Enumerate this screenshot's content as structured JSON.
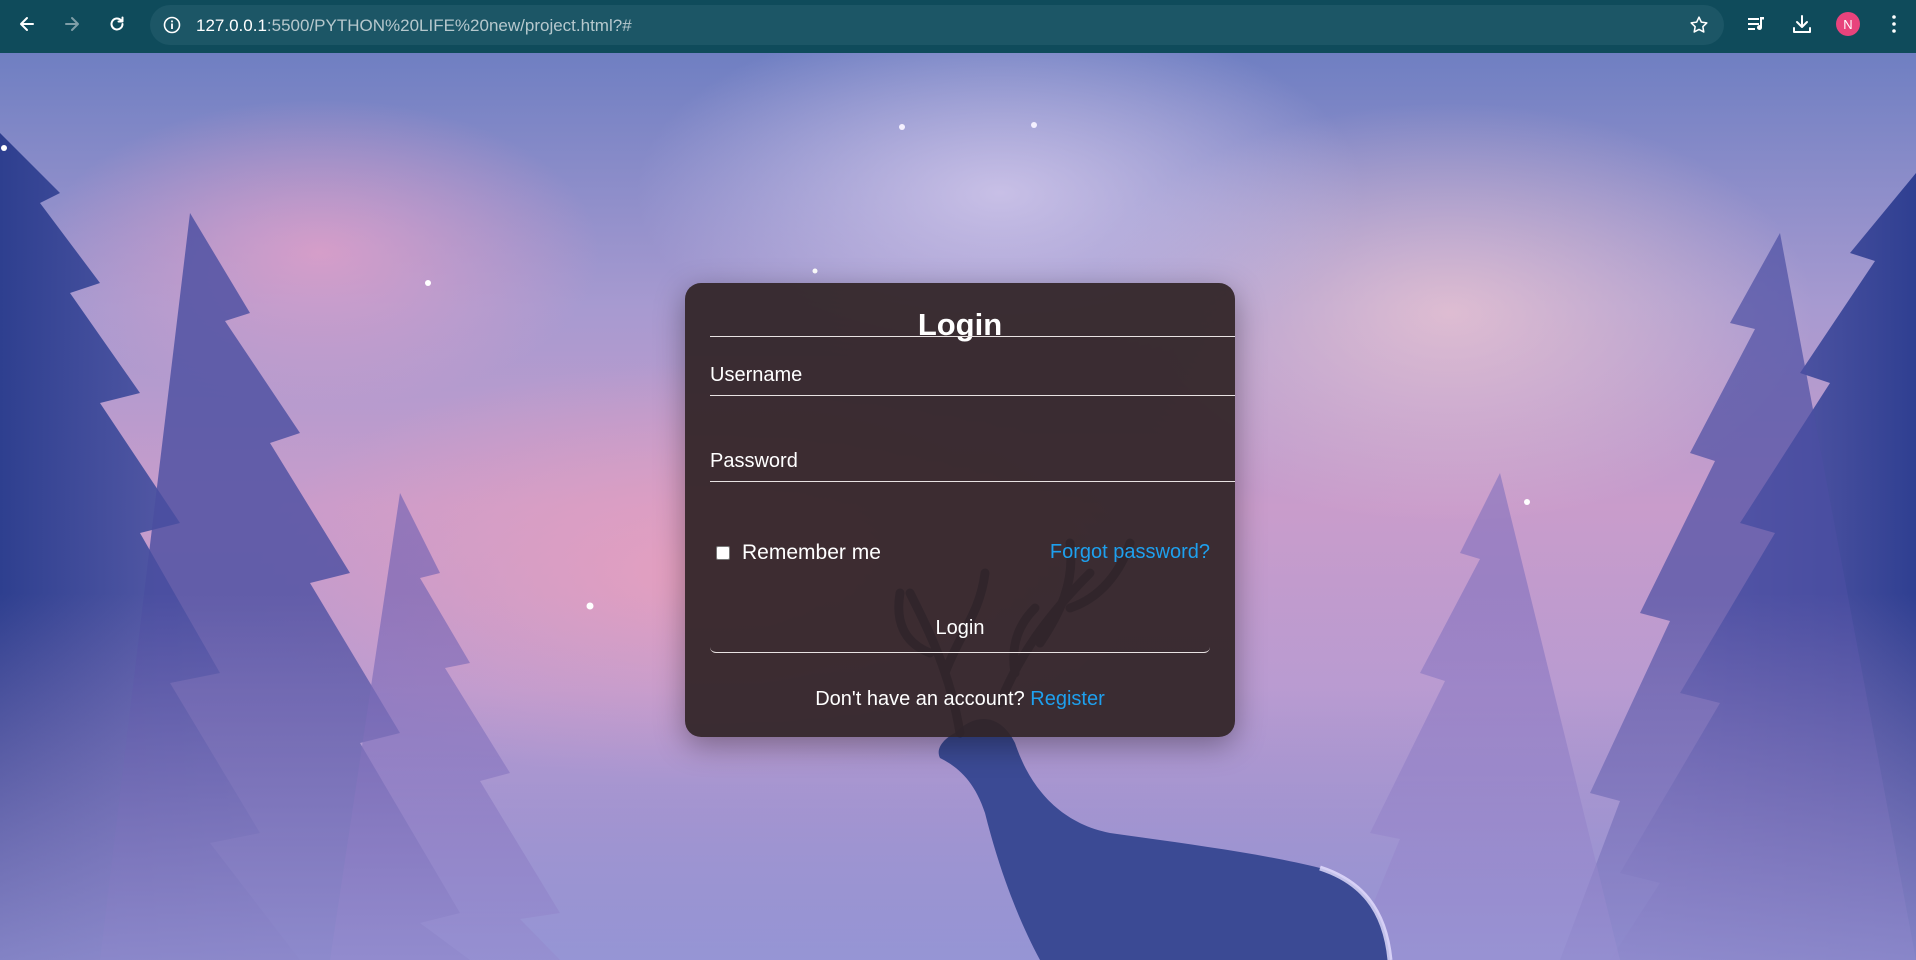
{
  "browser": {
    "url_host": "127.0.0.1",
    "url_path": ":5500/PYTHON%20LIFE%20new/project.html?#",
    "profile_initial": "N",
    "icons": [
      "back-icon",
      "forward-icon",
      "reload-icon",
      "site-info-icon",
      "bookmark-star-icon",
      "media-controls-icon",
      "download-icon",
      "more-menu-icon"
    ]
  },
  "login": {
    "title": "Login",
    "username_label": "Username",
    "password_label": "Password",
    "remember_label": "Remember me",
    "remember_checked": false,
    "forgot_link": "Forgot password?",
    "submit_label": "Login",
    "no_account_text": "Don't have an account?",
    "register_link": "Register"
  },
  "colors": {
    "chrome": "#0f4b5b",
    "card": "#302426",
    "link": "#1ea0ee",
    "avatar": "#e8437c"
  }
}
